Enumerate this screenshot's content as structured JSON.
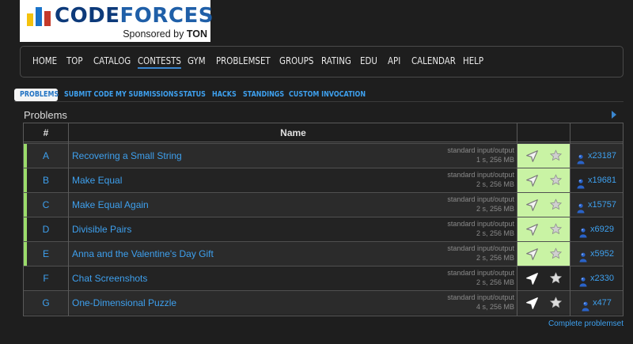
{
  "logo": {
    "name_prefix": "Code",
    "name_suffix": "forces",
    "sponsor_text": "Sponsored by ",
    "sponsor_brand": "TON"
  },
  "nav": [
    {
      "label": "HOME",
      "icon": null
    },
    {
      "label": "TOP"
    },
    {
      "label": "CATALOG"
    },
    {
      "label": "CONTESTS",
      "active": true
    },
    {
      "label": "GYM"
    },
    {
      "label": "PROBLEMSET"
    },
    {
      "label": "GROUPS"
    },
    {
      "label": "RATING"
    },
    {
      "label": "EDU"
    },
    {
      "label": "API"
    },
    {
      "label": "CALENDAR"
    },
    {
      "label": "HELP"
    }
  ],
  "subnav": [
    {
      "label": "PROBLEMS",
      "active": true
    },
    {
      "label": "SUBMIT CODE"
    },
    {
      "label": "MY SUBMISSIONS"
    },
    {
      "label": "STATUS"
    },
    {
      "label": "HACKS"
    },
    {
      "label": "STANDINGS"
    },
    {
      "label": "CUSTOM INVOCATION"
    }
  ],
  "problems": {
    "title": "Problems",
    "columns": {
      "index": "#",
      "name": "Name"
    },
    "rows": [
      {
        "index": "A",
        "name": "Recovering a Small String",
        "io": "standard input/output",
        "limits": "1 s, 256 MB",
        "solved_by": "x23187",
        "solved": true
      },
      {
        "index": "B",
        "name": "Make Equal",
        "io": "standard input/output",
        "limits": "2 s, 256 MB",
        "solved_by": "x19681",
        "solved": true
      },
      {
        "index": "C",
        "name": "Make Equal Again",
        "io": "standard input/output",
        "limits": "2 s, 256 MB",
        "solved_by": "x15757",
        "solved": true
      },
      {
        "index": "D",
        "name": "Divisible Pairs",
        "io": "standard input/output",
        "limits": "2 s, 256 MB",
        "solved_by": "x6929",
        "solved": true
      },
      {
        "index": "E",
        "name": "Anna and the Valentine's Day Gift",
        "io": "standard input/output",
        "limits": "2 s, 256 MB",
        "solved_by": "x5952",
        "solved": true
      },
      {
        "index": "F",
        "name": "Chat Screenshots",
        "io": "standard input/output",
        "limits": "2 s, 256 MB",
        "solved_by": "x2330",
        "solved": false
      },
      {
        "index": "G",
        "name": "One-Dimensional Puzzle",
        "io": "standard input/output",
        "limits": "4 s, 256 MB",
        "solved_by": "x477",
        "solved": false
      }
    ],
    "complete_link": "Complete problemset"
  },
  "colors": {
    "background": "#1e1e1e",
    "link": "#3ea0ee",
    "solved_accent": "#9bdc6a",
    "solved_cell": "#c9f3a4",
    "row_odd": "#2b2b2b",
    "row_even": "#232323"
  }
}
